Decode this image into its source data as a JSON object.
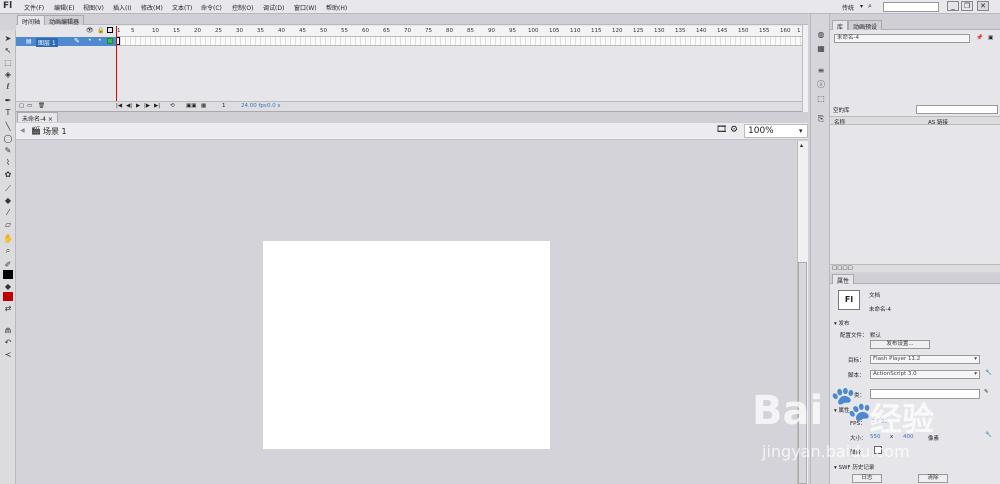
{
  "app": {
    "logo": "Fl"
  },
  "menu": [
    "文件(F)",
    "编辑(E)",
    "视图(V)",
    "插入(I)",
    "修改(M)",
    "文本(T)",
    "命令(C)",
    "控制(O)",
    "调试(D)",
    "窗口(W)",
    "帮助(H)"
  ],
  "workspace": {
    "label": "传统",
    "search_placeholder": ""
  },
  "window_controls": {
    "minimize": "_",
    "restore": "❐",
    "close": "✕"
  },
  "top_tabs": [
    "时间轴",
    "动画编辑器"
  ],
  "timeline": {
    "ruler": [
      "1",
      "5",
      "10",
      "15",
      "20",
      "25",
      "30",
      "35",
      "40",
      "45",
      "50",
      "55",
      "60",
      "65",
      "70",
      "75",
      "80",
      "85",
      "90",
      "95",
      "100",
      "105",
      "110",
      "115",
      "120",
      "125",
      "130",
      "135",
      "140",
      "145",
      "150",
      "155",
      "160",
      "1"
    ],
    "layer_name": "图层 1",
    "footer": {
      "frame": "1",
      "fps": "24.00 fps",
      "time": "0.0 s"
    }
  },
  "doc_tab": {
    "name": "未命名-4",
    "close": "×"
  },
  "edit_bar": {
    "scene": "场景 1",
    "zoom": "100%"
  },
  "right_panel": {
    "top_tabs": [
      "库",
      "动画预设"
    ],
    "library": {
      "doc_select": "未命名-4",
      "columns": {
        "name": "名称",
        "linkage": "AS 链接"
      },
      "count_label": "空的库"
    },
    "properties": {
      "tab": "属性",
      "doc_icon": "Fl",
      "doc_type": "文档",
      "doc_name": "未命名-4",
      "publish_header": "发布",
      "profile_label": "配置文件：",
      "profile_value": "默认",
      "publish_settings_btn": "发布设置...",
      "target_label": "目标：",
      "target_value": "Flash Player 11.2",
      "script_label": "脚本：",
      "script_value": "ActionScript 3.0",
      "class_label": "类：",
      "props_header": "属性",
      "fps_label": "FPS：",
      "fps_value": "24.00",
      "size_label": "大小：",
      "width": "550",
      "x": "x",
      "height": "400",
      "unit": "像素",
      "stage_label": "舞台：",
      "swf_header": "SWF 历史记录",
      "log_btn": "日志",
      "clear_btn": "清除"
    }
  },
  "watermark": {
    "brand_a": "Bai",
    "brand_b": "经验",
    "url": "jingyan.baidu.com"
  }
}
